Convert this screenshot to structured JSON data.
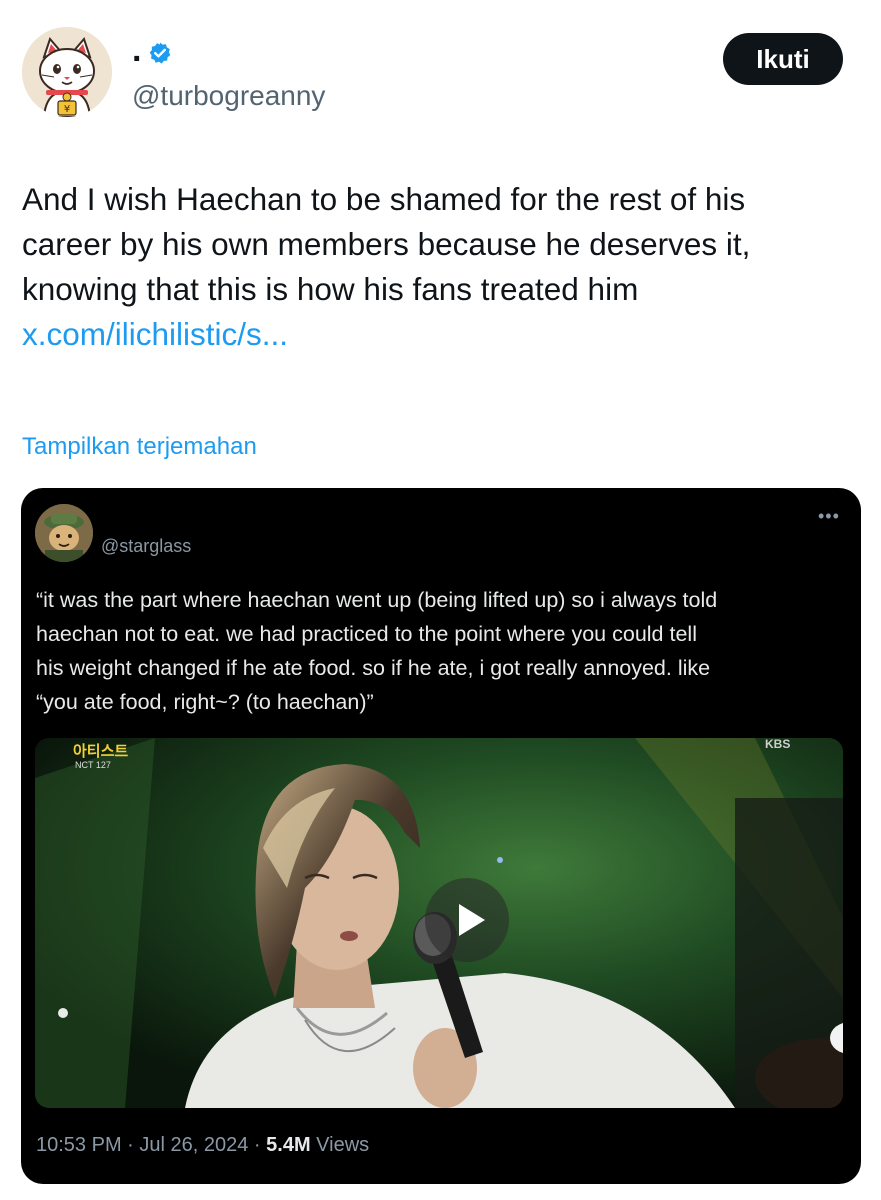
{
  "author": {
    "display_name": ".",
    "handle": "@turbogreanny",
    "avatar_icon": "lucky-cat-avatar",
    "verified": true
  },
  "follow_button": {
    "label": "Ikuti"
  },
  "tweet": {
    "lines": [
      "And I wish Haechan to be shamed for the rest of his",
      "career by his own members because he deserves it,",
      "knowing that this is how his fans treated him"
    ],
    "link": "x.com/ilichilistic/s..."
  },
  "translate_link": "Tampilkan terjemahan",
  "embedded_post": {
    "handle": "@starglass",
    "more_icon": "more-dots-icon",
    "quote_lines": [
      "“it was the part where haechan went up (being lifted up) so i always told",
      "haechan not to eat. we had practiced to the point where you could tell",
      "his weight changed if he ate food. so if he ate, i got really annoyed. like",
      "“you ate food, right~? (to haechan)”"
    ],
    "video": {
      "show_logo": "아티스트",
      "show_sub": "NCT 127",
      "broadcaster": "KBS",
      "play_icon": "play-icon"
    },
    "meta": {
      "time": "10:53 PM",
      "separator": " · ",
      "date": "Jul 26, 2024",
      "views_count": "5.4M",
      "views_label": " Views"
    }
  },
  "colors": {
    "link": "#1d9bf0",
    "text": "#0f1419",
    "secondary": "#536471",
    "verified": "#1d9bf0"
  }
}
